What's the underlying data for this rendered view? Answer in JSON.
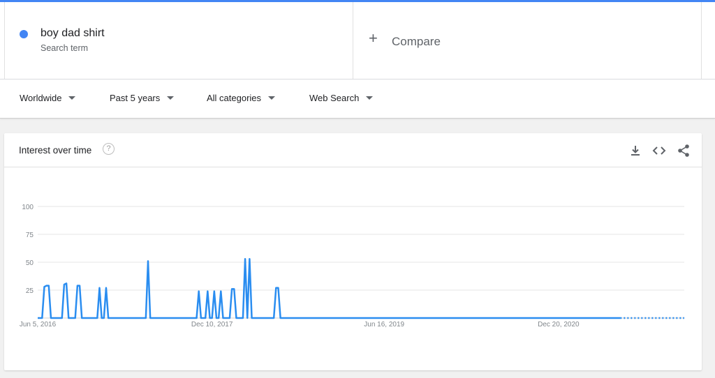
{
  "search_term": {
    "name": "boy dad shirt",
    "sublabel": "Search term",
    "color": "#4285f4"
  },
  "compare": {
    "label": "Compare",
    "icon": "plus-icon"
  },
  "filters": [
    {
      "label": "Worldwide"
    },
    {
      "label": "Past 5 years"
    },
    {
      "label": "All categories"
    },
    {
      "label": "Web Search"
    }
  ],
  "card": {
    "title": "Interest over time",
    "help_icon": "?",
    "tools": [
      "download-icon",
      "embed-icon",
      "share-icon"
    ]
  },
  "chart_data": {
    "type": "line",
    "title": "Interest over time",
    "xlabel": "",
    "ylabel": "",
    "ylim": [
      0,
      100
    ],
    "y_ticks": [
      100,
      75,
      50,
      25
    ],
    "x_tick_labels": [
      "Jun 5, 2016",
      "Dec 10, 2017",
      "Jun 16, 2019",
      "Dec 20, 2020"
    ],
    "x_tick_indices": [
      0,
      79,
      157,
      236
    ],
    "partial_from_index": 264,
    "grid": true,
    "line_color": "#2a8df0",
    "series": [
      {
        "values": [
          0,
          0,
          0,
          28,
          29,
          29,
          0,
          0,
          0,
          0,
          0,
          0,
          30,
          31,
          0,
          0,
          0,
          0,
          29,
          29,
          0,
          0,
          0,
          0,
          0,
          0,
          0,
          0,
          27,
          0,
          0,
          27,
          0,
          0,
          0,
          0,
          0,
          0,
          0,
          0,
          0,
          0,
          0,
          0,
          0,
          0,
          0,
          0,
          0,
          0,
          51,
          0,
          0,
          0,
          0,
          0,
          0,
          0,
          0,
          0,
          0,
          0,
          0,
          0,
          0,
          0,
          0,
          0,
          0,
          0,
          0,
          0,
          0,
          24,
          0,
          0,
          0,
          24,
          0,
          0,
          24,
          0,
          0,
          24,
          0,
          0,
          0,
          0,
          26,
          26,
          0,
          0,
          0,
          0,
          53,
          0,
          53,
          0,
          0,
          0,
          0,
          0,
          0,
          0,
          0,
          0,
          0,
          0,
          27,
          27,
          0,
          0,
          0,
          0,
          0,
          0,
          0,
          0,
          0,
          0,
          0,
          0,
          0,
          0,
          0,
          0,
          0,
          0,
          0,
          0,
          0,
          0,
          0,
          0,
          0,
          0,
          0,
          0,
          0,
          0,
          0,
          0,
          0,
          0,
          0,
          0,
          0,
          0,
          0,
          0,
          0,
          0,
          0,
          0,
          0,
          0,
          0,
          0,
          0,
          0,
          0,
          0,
          0,
          0,
          0,
          0,
          0,
          0,
          0,
          0,
          0,
          0,
          0,
          0,
          0,
          0,
          0,
          0,
          0,
          0,
          0,
          0,
          0,
          0,
          0,
          0,
          0,
          0,
          0,
          0,
          0,
          0,
          0,
          0,
          0,
          0,
          0,
          0,
          0,
          0,
          0,
          0,
          0,
          0,
          0,
          0,
          0,
          0,
          0,
          0,
          0,
          0,
          0,
          0,
          0,
          0,
          0,
          0,
          0,
          0,
          0,
          0,
          0,
          0,
          0,
          0,
          0,
          0,
          0,
          0,
          0,
          0,
          0,
          0,
          0,
          0,
          0,
          0,
          0,
          0,
          0,
          0,
          0,
          0,
          0,
          0,
          0,
          0,
          0,
          0,
          0,
          0,
          0,
          0,
          0,
          0,
          0,
          0,
          0,
          0,
          0,
          0,
          0,
          0,
          0,
          0,
          0,
          0,
          0,
          0,
          0,
          0,
          0,
          0,
          0,
          0,
          0,
          0,
          0,
          0,
          0,
          0,
          0,
          0,
          0,
          0,
          0,
          0,
          0,
          0,
          0,
          0,
          0,
          0
        ]
      }
    ]
  }
}
